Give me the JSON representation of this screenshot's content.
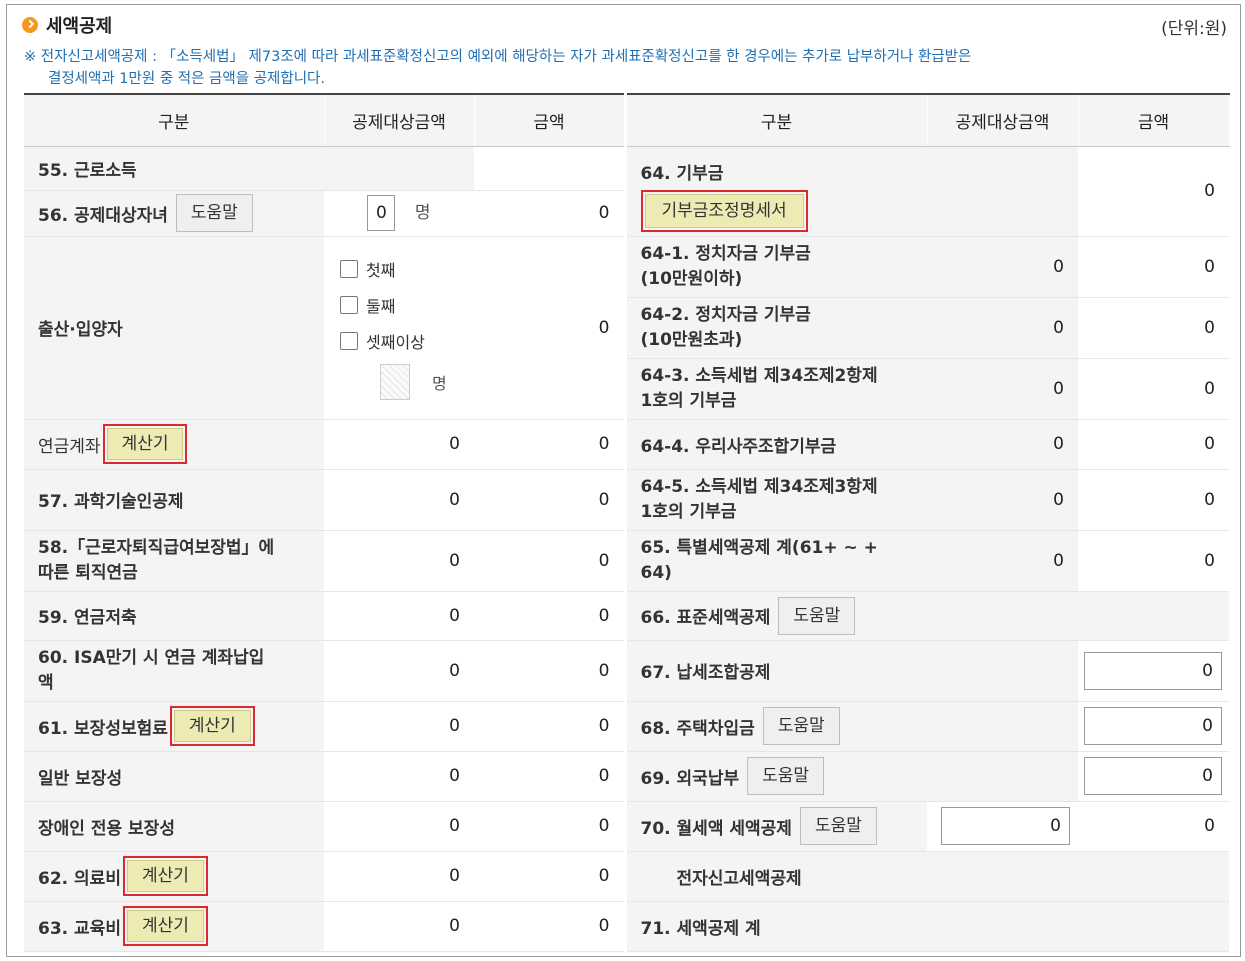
{
  "header": {
    "title": "세액공제",
    "unit": "(단위:원)",
    "notice_line1": "※ 전자신고세액공제 : 「소득세법」 제73조에 따라 과세표준확정신고의 예외에 해당하는 자가 과세표준확정신고를 한 경우에는 추가로 납부하거나 환급받은",
    "notice_line2": "결정세액과 1만원 중 적은 금액을 공제합니다."
  },
  "columns": {
    "category": "구분",
    "target_amount": "공제대상금액",
    "amount": "금액"
  },
  "buttons": {
    "help": "도움말",
    "calc": "계산기",
    "donation_statement": "기부금조정명세서"
  },
  "left": {
    "r55": {
      "label": "55. 근로소득"
    },
    "r56": {
      "label": "56. 공제대상자녀",
      "count": "0",
      "count_unit": "명",
      "amount": "0"
    },
    "birth": {
      "label": "출산·입양자",
      "opt1": "첫째",
      "opt2": "둘째",
      "opt3": "셋째이상",
      "count_unit": "명",
      "amount": "0"
    },
    "pension_acct": {
      "label": "연금계좌",
      "target": "0",
      "amount": "0"
    },
    "r57": {
      "label": "57. 과학기술인공제",
      "target": "0",
      "amount": "0"
    },
    "r58": {
      "label_l1": "58.「근로자퇴직급여보장법」에",
      "label_l2": "따른 퇴직연금",
      "target": "0",
      "amount": "0"
    },
    "r59": {
      "label": "59. 연금저축",
      "target": "0",
      "amount": "0"
    },
    "r60": {
      "label_l1": "60. ISA만기 시 연금 계좌납입",
      "label_l2": "액",
      "target": "0",
      "amount": "0"
    },
    "r61": {
      "label": "61. 보장성보험료",
      "target": "0",
      "amount": "0"
    },
    "general": {
      "label": "일반 보장성",
      "target": "0",
      "amount": "0"
    },
    "disabled": {
      "label": "장애인 전용 보장성",
      "target": "0",
      "amount": "0"
    },
    "r62": {
      "label": "62. 의료비",
      "target": "0",
      "amount": "0"
    },
    "r63": {
      "label": "63. 교육비",
      "target": "0",
      "amount": "0"
    }
  },
  "right": {
    "r64": {
      "label": "64. 기부금",
      "amount": "0"
    },
    "r64_1": {
      "label_l1": "64-1. 정치자금 기부금",
      "label_l2": "(10만원이하)",
      "target": "0",
      "amount": "0"
    },
    "r64_2": {
      "label_l1": "64-2. 정치자금 기부금",
      "label_l2": "(10만원초과)",
      "target": "0",
      "amount": "0"
    },
    "r64_3": {
      "label_l1": "64-3. 소득세법 제34조제2항제",
      "label_l2": "1호의 기부금",
      "target": "0",
      "amount": "0"
    },
    "r64_4": {
      "label": "64-4. 우리사주조합기부금",
      "target": "0",
      "amount": "0"
    },
    "r64_5": {
      "label_l1": "64-5. 소득세법 제34조제3항제",
      "label_l2": "1호의 기부금",
      "target": "0",
      "amount": "0"
    },
    "r65": {
      "label_l1": "65. 특별세액공제 계(61+ ~ +",
      "label_l2": "64)",
      "target": "0",
      "amount": "0"
    },
    "r66": {
      "label": "66. 표준세액공제"
    },
    "r67": {
      "label": "67. 납세조합공제",
      "amount": "0"
    },
    "r68": {
      "label": "68. 주택차입금",
      "amount": "0"
    },
    "r69": {
      "label": "69. 외국납부",
      "amount": "0"
    },
    "r70": {
      "label": "70. 월세액 세액공제",
      "target": "0",
      "amount": "0"
    },
    "e_filing": {
      "label": "전자신고세액공제"
    },
    "r71": {
      "label": "71. 세액공제 계"
    }
  }
}
